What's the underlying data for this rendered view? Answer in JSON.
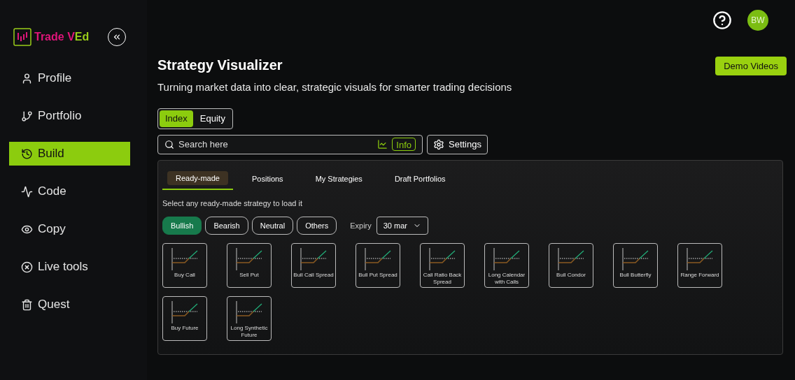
{
  "brand": {
    "name_part1": "Trade V",
    "name_part2": "Ed"
  },
  "sidebar": {
    "items": [
      {
        "label": "Profile",
        "kind": "profile",
        "selected": false
      },
      {
        "label": "Portfolio",
        "kind": "portfolio",
        "selected": false
      },
      {
        "label": "Build",
        "kind": "build",
        "selected": true
      },
      {
        "label": "Code",
        "kind": "code",
        "selected": false
      },
      {
        "label": "Copy",
        "kind": "copy",
        "selected": false
      },
      {
        "label": "Live tools",
        "kind": "live",
        "selected": false
      },
      {
        "label": "Quest",
        "kind": "quest",
        "selected": false
      }
    ]
  },
  "header": {
    "avatar": "BW"
  },
  "page": {
    "title": "Strategy Visualizer",
    "subtitle": "Turning market data into clear, strategic visuals for smarter trading decisions",
    "demo_button": "Demo Videos"
  },
  "segment": [
    {
      "label": "Index",
      "selected": true
    },
    {
      "label": "Equity",
      "selected": false
    }
  ],
  "search": {
    "placeholder": "Search here",
    "info": "Info",
    "settings": "Settings"
  },
  "tabs": [
    {
      "label": "Ready-made",
      "selected": true
    },
    {
      "label": "Positions",
      "selected": false
    },
    {
      "label": "My Strategies",
      "selected": false
    },
    {
      "label": "Draft Portfolios",
      "selected": false
    }
  ],
  "hint": "Select any ready-made strategy to load it",
  "filters": [
    {
      "label": "Bullish",
      "selected": true
    },
    {
      "label": "Bearish",
      "selected": false
    },
    {
      "label": "Neutral",
      "selected": false
    },
    {
      "label": "Others",
      "selected": false
    }
  ],
  "expiry": {
    "label": "Expiry",
    "value": "30 mar"
  },
  "strategies": [
    {
      "name": "Buy Call"
    },
    {
      "name": "Sell Put"
    },
    {
      "name": "Bull Call Spread"
    },
    {
      "name": "Bull Put Spread"
    },
    {
      "name": "Call Ratio Back Spread"
    },
    {
      "name": "Long Calendar with Calls"
    },
    {
      "name": "Bull Condor"
    },
    {
      "name": "Bull Butterfly"
    },
    {
      "name": "Range Forward"
    },
    {
      "name": "Buy Future"
    },
    {
      "name": "Long Synthetic Future"
    }
  ]
}
